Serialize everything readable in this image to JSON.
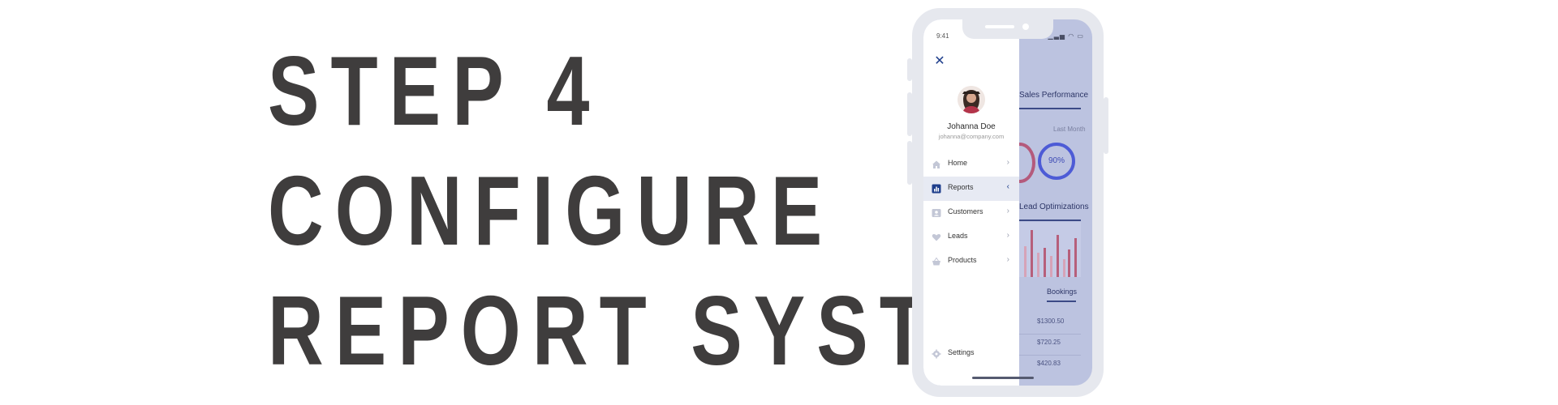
{
  "headline": {
    "line1": "STEP 4",
    "line2": "CONFIGURE",
    "line3": "REPORT SYSTEM"
  },
  "phone": {
    "status_time": "9:41",
    "status_right": "▁▃▅ ◠ ▭",
    "profile": {
      "name": "Johanna Doe",
      "email": "johanna@company.com"
    },
    "close_icon": "close-icon",
    "menu": [
      {
        "label": "Home",
        "icon": "home-icon",
        "chevron": "›",
        "active": false
      },
      {
        "label": "Reports",
        "icon": "bar-chart-icon",
        "chevron": "‹",
        "active": true
      },
      {
        "label": "Customers",
        "icon": "contact-card-icon",
        "chevron": "›",
        "active": false
      },
      {
        "label": "Leads",
        "icon": "heart-icon",
        "chevron": "›",
        "active": false
      },
      {
        "label": "Products",
        "icon": "basket-icon",
        "chevron": "›",
        "active": false
      }
    ],
    "settings_label": "Settings",
    "dashboard": {
      "title": "Sales Performance",
      "last_month_label": "Last Month",
      "last_month_value": "90%",
      "lead_title": "Lead Optimizations",
      "bookings_label": "Bookings",
      "bookings": [
        "$1300.50",
        "$720.25",
        "$420.83"
      ]
    },
    "colors": {
      "accent": "#1f3f8c",
      "dashboard_bg": "#bcc3e0",
      "donut": "#4d5bd6",
      "bars": "#b65f7b"
    }
  }
}
